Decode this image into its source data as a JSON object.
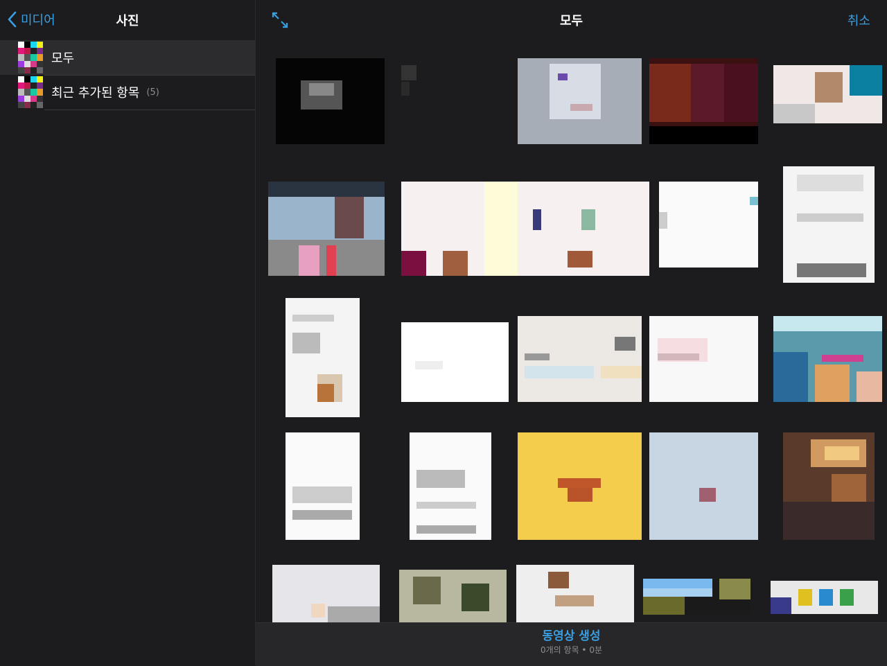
{
  "sidebar": {
    "back_label": "미디어",
    "title": "사진",
    "albums": [
      {
        "label": "모두",
        "count": ""
      },
      {
        "label": "최근 추가된 항목",
        "count": "(5)"
      }
    ]
  },
  "main": {
    "title": "모두",
    "cancel_label": "취소"
  },
  "bottom": {
    "create_label": "동영상 생성",
    "summary": "0개의 항목 • 0분"
  },
  "colors": {
    "accent": "#3a9fe0",
    "background": "#1c1c1e",
    "selected_row": "#2c2c2e"
  },
  "icons": {
    "back": "chevron-left-icon",
    "expand": "expand-arrows-icon"
  }
}
